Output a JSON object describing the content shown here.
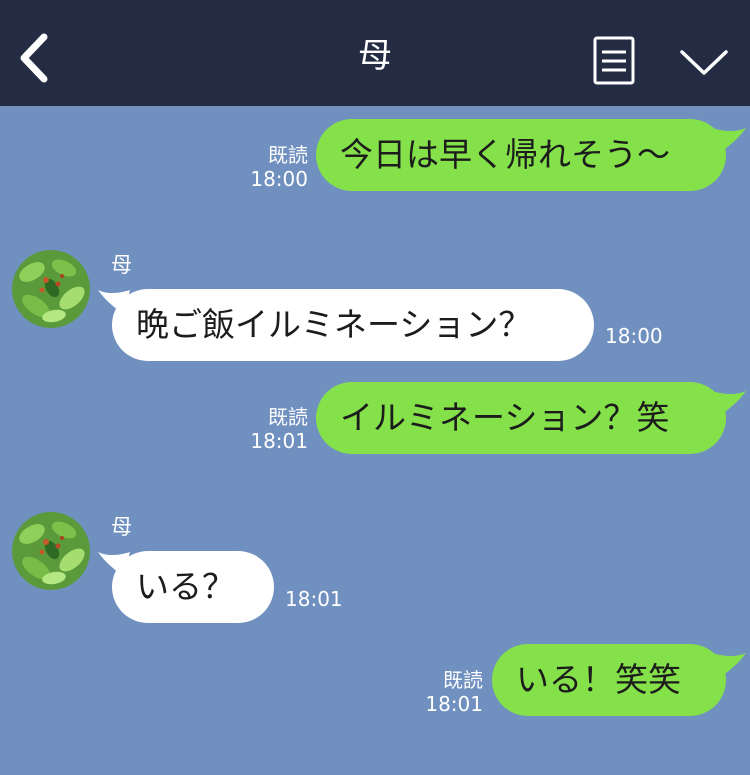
{
  "header": {
    "title": "母",
    "background": "#242c44",
    "back_icon": "chevron-left-icon",
    "menu_icon": "note-list-icon",
    "collapse_icon": "chevron-down-icon"
  },
  "colors": {
    "chat_background": "#7090c0",
    "outgoing_bubble": "#84e14a",
    "incoming_bubble": "#ffffff"
  },
  "messages": [
    {
      "direction": "outgoing",
      "text": "今日は早く帰れそう〜",
      "read_label": "既読",
      "time": "18:00"
    },
    {
      "direction": "incoming",
      "sender": "母",
      "text": "晩ご飯イルミネーション？",
      "time": "18:00"
    },
    {
      "direction": "outgoing",
      "text": "イルミネーション？笑",
      "read_label": "既読",
      "time": "18:01"
    },
    {
      "direction": "incoming",
      "sender": "母",
      "text": "いる？",
      "time": "18:01"
    },
    {
      "direction": "outgoing",
      "text": "いる！笑笑",
      "read_label": "既読",
      "time": "18:01"
    }
  ]
}
